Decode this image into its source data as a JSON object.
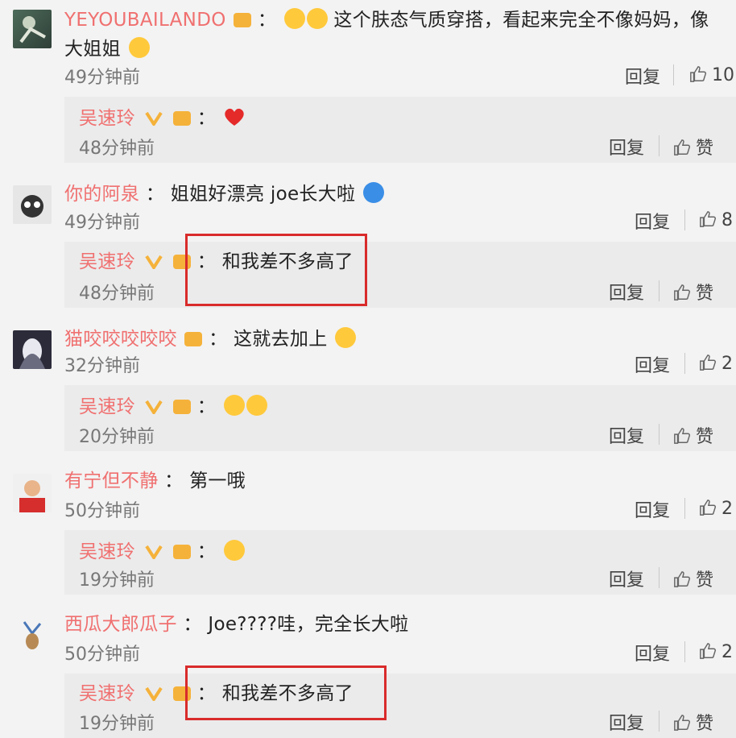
{
  "comments": [
    {
      "user": "YEYOUBAILANDO",
      "sep": "：",
      "text": "这个肤态气质穿搭，看起来完全不像妈妈，像大姐姐",
      "time": "49分钟前",
      "reply_label": "回复",
      "likes": "10",
      "reply": {
        "user": "吴速玲",
        "sep": "：",
        "text": "",
        "time": "48分钟前",
        "reply_label": "回复",
        "likes": "赞"
      }
    },
    {
      "user": "你的阿泉",
      "sep": "：",
      "text": "姐姐好漂亮 joe长大啦",
      "time": "49分钟前",
      "reply_label": "回复",
      "likes": "8",
      "reply": {
        "user": "吴速玲",
        "sep": "：",
        "text": "和我差不多高了",
        "time": "48分钟前",
        "reply_label": "回复",
        "likes": "赞"
      }
    },
    {
      "user": "猫咬咬咬咬咬",
      "sep": "：",
      "text": "这就去加上",
      "time": "32分钟前",
      "reply_label": "回复",
      "likes": "2",
      "reply": {
        "user": "吴速玲",
        "sep": "：",
        "text": "",
        "time": "20分钟前",
        "reply_label": "回复",
        "likes": "赞"
      }
    },
    {
      "user": "有宁但不静",
      "sep": "：",
      "text": "第一哦",
      "time": "50分钟前",
      "reply_label": "回复",
      "likes": "2",
      "reply": {
        "user": "吴速玲",
        "sep": "：",
        "text": "",
        "time": "19分钟前",
        "reply_label": "回复",
        "likes": "赞"
      }
    },
    {
      "user": "西瓜大郎瓜子",
      "sep": "：",
      "text": "Joe????哇，完全长大啦",
      "time": "50分钟前",
      "reply_label": "回复",
      "likes": "2",
      "reply": {
        "user": "吴速玲",
        "sep": "：",
        "text": "和我差不多高了",
        "time": "19分钟前",
        "reply_label": "回复",
        "likes": "赞"
      }
    }
  ],
  "colors": {
    "username": "#f07070",
    "highlight": "#d92b2b",
    "verified": "#f5b23a"
  },
  "icons": {
    "like": "thumbs-up-icon",
    "verified": "verified-v-icon",
    "heart": "heart-emoji-icon"
  }
}
